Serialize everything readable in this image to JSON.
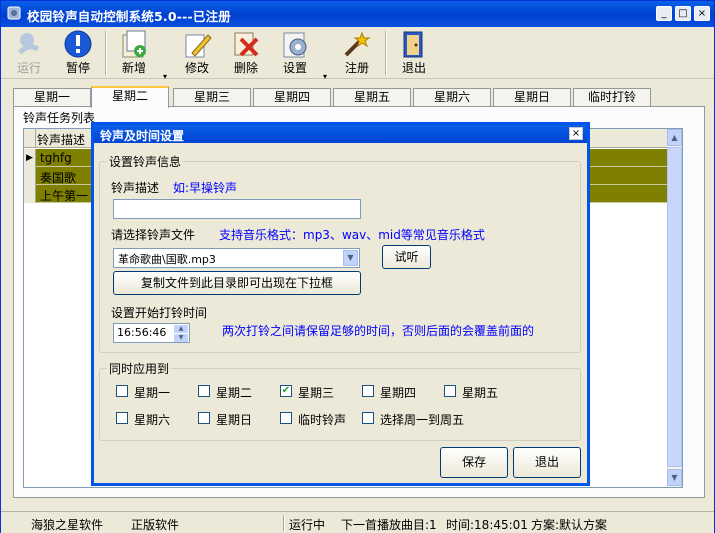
{
  "window": {
    "title": "校园铃声自动控制系统5.0---已注册",
    "min": "_",
    "max": "□",
    "close": "×"
  },
  "toolbar": {
    "run": "运行",
    "pause": "暂停",
    "add": "新增",
    "edit": "修改",
    "delete": "删除",
    "settings": "设置",
    "register": "注册",
    "exit": "退出",
    "dropdown_arrow": "▾"
  },
  "tabs": [
    "星期一",
    "星期二",
    "星期三",
    "星期四",
    "星期五",
    "星期六",
    "星期日",
    "临时打铃"
  ],
  "active_tab": "星期二",
  "task_list": {
    "group_label": "铃声任务列表",
    "header": "铃声描述",
    "rows": [
      "tghfg",
      "奏国歌",
      "上午第一"
    ],
    "row_marker": "▶"
  },
  "status_bar": {
    "company": "海狼之星软件",
    "license": "正版软件",
    "state": "运行中",
    "next_item": "下一首播放曲目:1",
    "time": "时间:18:45:01",
    "plan": "方案:默认方案"
  },
  "dialog": {
    "title": "铃声及时间设置",
    "close": "×",
    "ring_info_group": "设置铃声信息",
    "desc_label": "铃声描述",
    "desc_hint": "如:早操铃声",
    "desc_value": "",
    "file_label": "请选择铃声文件",
    "file_hint": "支持音乐格式：mp3、wav、mid等常见音乐格式",
    "file_value": "革命歌曲\\国歌.mp3",
    "audition_button": "试听",
    "copy_button": "复制文件到此目录即可出现在下拉框",
    "start_time_label": "设置开始打铃时间",
    "start_time_value": "16:56:46",
    "time_hint": "两次打铃之间请保留足够的时间，否则后面的会覆盖前面的",
    "apply_group": "同时应用到",
    "checkboxes": [
      {
        "label": "星期一",
        "checked": false
      },
      {
        "label": "星期二",
        "checked": false
      },
      {
        "label": "星期三",
        "checked": true
      },
      {
        "label": "星期四",
        "checked": false
      },
      {
        "label": "星期五",
        "checked": false
      },
      {
        "label": "星期六",
        "checked": false
      },
      {
        "label": "星期日",
        "checked": false
      },
      {
        "label": "临时铃声",
        "checked": false
      },
      {
        "label": "选择周一到周五",
        "checked": false
      }
    ],
    "save_button": "保存",
    "exit_button": "退出"
  },
  "colors": {
    "titlebar": "#0a50e0",
    "highlight_row": "#808000",
    "hint_text": "#0000ff",
    "face": "#ece9d8"
  }
}
